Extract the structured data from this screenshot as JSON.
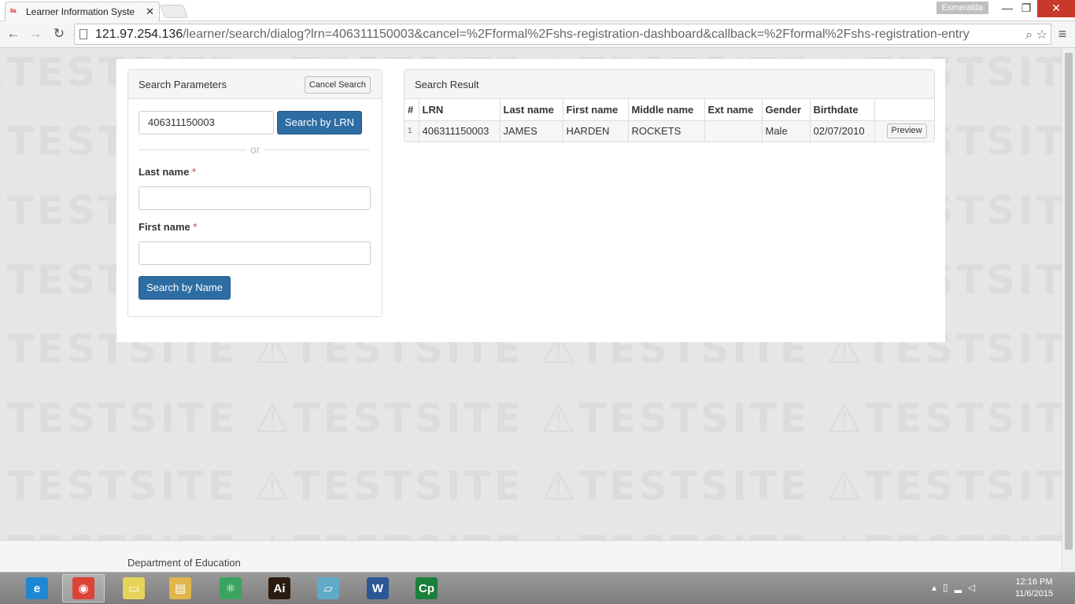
{
  "browser": {
    "tab_title": "Learner Information Syste",
    "tab_favicon_text": "lis",
    "profile_name": "Esmeralda",
    "url_host": "121.97.254.136",
    "url_path": "/learner/search/dialog?lrn=406311150003&cancel=%2Fformal%2Fshs-registration-dashboard&callback=%2Fformal%2Fshs-registration-entry"
  },
  "watermark": {
    "text": "⚠TESTSITE   ⚠TESTSITE   ⚠TESTSITE   ⚠TESTSITE"
  },
  "search_params": {
    "title": "Search Parameters",
    "cancel_label": "Cancel Search",
    "lrn_value": "406311150003",
    "search_lrn_label": "Search by LRN",
    "or_text": "or",
    "last_name_label": "Last name",
    "first_name_label": "First name",
    "required_mark": "*",
    "search_name_label": "Search by Name"
  },
  "results": {
    "title": "Search Result",
    "columns": [
      "#",
      "LRN",
      "Last name",
      "First name",
      "Middle name",
      "Ext name",
      "Gender",
      "Birthdate"
    ],
    "rows": [
      {
        "num": "1",
        "lrn": "406311150003",
        "last_name": "JAMES",
        "first_name": "HARDEN",
        "middle_name": "ROCKETS",
        "ext_name": "",
        "gender": "Male",
        "birthdate": "02/07/2010",
        "action": "Preview"
      }
    ]
  },
  "footer": {
    "text": "Department of Education"
  },
  "taskbar": {
    "apps": [
      {
        "name": "ie-icon",
        "glyph": "e",
        "color": "#1e88d3"
      },
      {
        "name": "chrome-icon",
        "glyph": "◉",
        "color": "#db4437"
      },
      {
        "name": "sticky-notes-icon",
        "glyph": "▭",
        "color": "#e6d35a"
      },
      {
        "name": "file-explorer-icon",
        "glyph": "▤",
        "color": "#e0b64a"
      },
      {
        "name": "atom-icon",
        "glyph": "⚛",
        "color": "#3aa35f"
      },
      {
        "name": "illustrator-icon",
        "glyph": "Ai",
        "color": "#2b1b0f"
      },
      {
        "name": "notepad-icon",
        "glyph": "▱",
        "color": "#5fa9c9"
      },
      {
        "name": "word-icon",
        "glyph": "W",
        "color": "#2b5797"
      },
      {
        "name": "captivate-icon",
        "glyph": "Cp",
        "color": "#1a7f3a"
      }
    ],
    "time": "12:16 PM",
    "date": "11/6/2015"
  }
}
